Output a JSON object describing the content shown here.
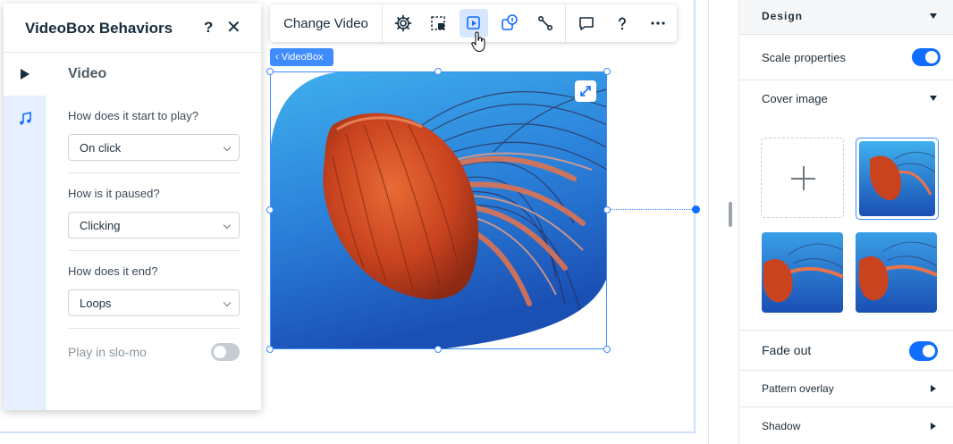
{
  "behaviors_panel": {
    "title": "VideoBox Behaviors",
    "help_label": "?",
    "close_label": "✕",
    "section_title": "Video",
    "questions": [
      {
        "label": "How does it start to play?",
        "value": "On click"
      },
      {
        "label": "How is it paused?",
        "value": "Clicking"
      },
      {
        "label": "How does it end?",
        "value": "Loops"
      }
    ],
    "slomo_label": "Play in slo-mo",
    "slomo_on": false,
    "tabs": [
      {
        "icon": "play-icon",
        "active": true
      },
      {
        "icon": "music-note-icon",
        "active": false
      }
    ]
  },
  "toolbar": {
    "change_label": "Change Video",
    "buttons": [
      "settings-icon",
      "crop-icon",
      "video-play-icon",
      "animation-icon",
      "connect-icon",
      "comment-icon",
      "help-icon",
      "more-icon"
    ],
    "active_button": "video-play-icon"
  },
  "element_tag": "‹ VideoBox",
  "design_panel": {
    "title": "Design",
    "scale_label": "Scale properties",
    "scale_on": true,
    "cover_label": "Cover image",
    "fade_label": "Fade out",
    "fade_on": true,
    "pattern_label": "Pattern overlay",
    "shadow_label": "Shadow"
  },
  "colors": {
    "accent": "#116dff",
    "selection": "#3f8cff",
    "water_top": "#3fb0ee",
    "water_bottom": "#1a4fb4",
    "jelly": "#d4502a"
  }
}
